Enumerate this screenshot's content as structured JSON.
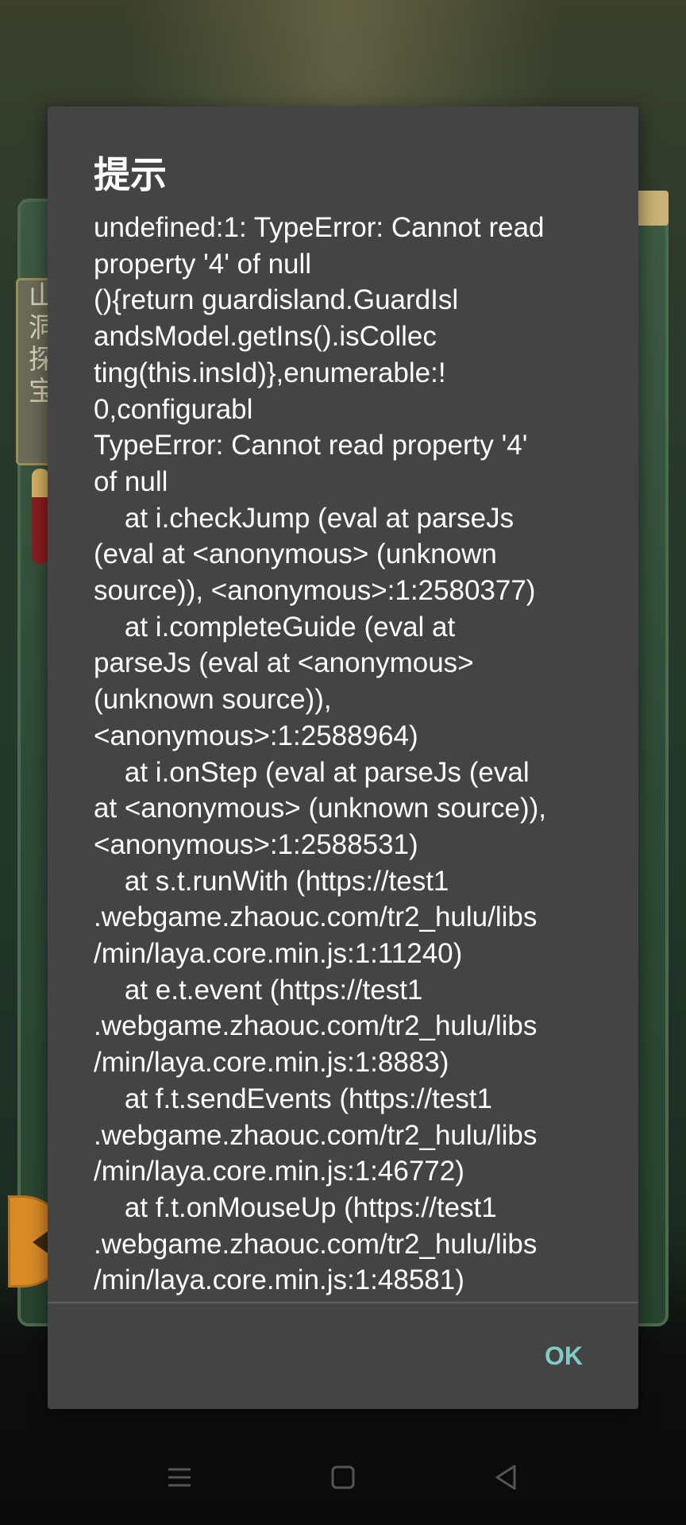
{
  "dialog": {
    "title": "提示",
    "message_lines": [
      "undefined:1: TypeError: Cannot read",
      "property '4' of null",
      "(){return guardisland.GuardIsl",
      "andsModel.getIns().isCollec",
      "ting(this.insId)},enumerable:!",
      "0,configurabl",
      "TypeError: Cannot read property '4'",
      "of null",
      "    at i.checkJump (eval at parseJs",
      "(eval at <anonymous> (unknown",
      "source)), <anonymous>:1:2580377)",
      "    at i.completeGuide (eval at",
      "parseJs (eval at <anonymous>",
      "(unknown source)),",
      "<anonymous>:1:2588964)",
      "    at i.onStep (eval at parseJs (eval",
      "at <anonymous> (unknown source)),",
      "<anonymous>:1:2588531)",
      "    at s.t.runWith (https://test1",
      ".webgame.zhaouc.com/tr2_hulu/libs",
      "/min/laya.core.min.js:1:11240)",
      "    at e.t.event (https://test1",
      ".webgame.zhaouc.com/tr2_hulu/libs",
      "/min/laya.core.min.js:1:8883)",
      "    at f.t.sendEvents (https://test1",
      ".webgame.zhaouc.com/tr2_hulu/libs",
      "/min/laya.core.min.js:1:46772)",
      "    at f.t.onMouseUp (https://test1",
      ".webgame.zhaouc.com/tr2_hulu/libs",
      "/min/laya.core.min.js:1:48581)"
    ],
    "ok_label": "OK"
  },
  "background": {
    "card_text": "山洞探宝"
  },
  "nav_bar": {
    "icons": [
      "menu-icon",
      "home-icon",
      "back-icon"
    ]
  },
  "colors": {
    "dialog_background": "#444444",
    "dialog_text": "#ffffff",
    "ok_button": "#80cbc4",
    "divider": "#5d5d5d"
  }
}
